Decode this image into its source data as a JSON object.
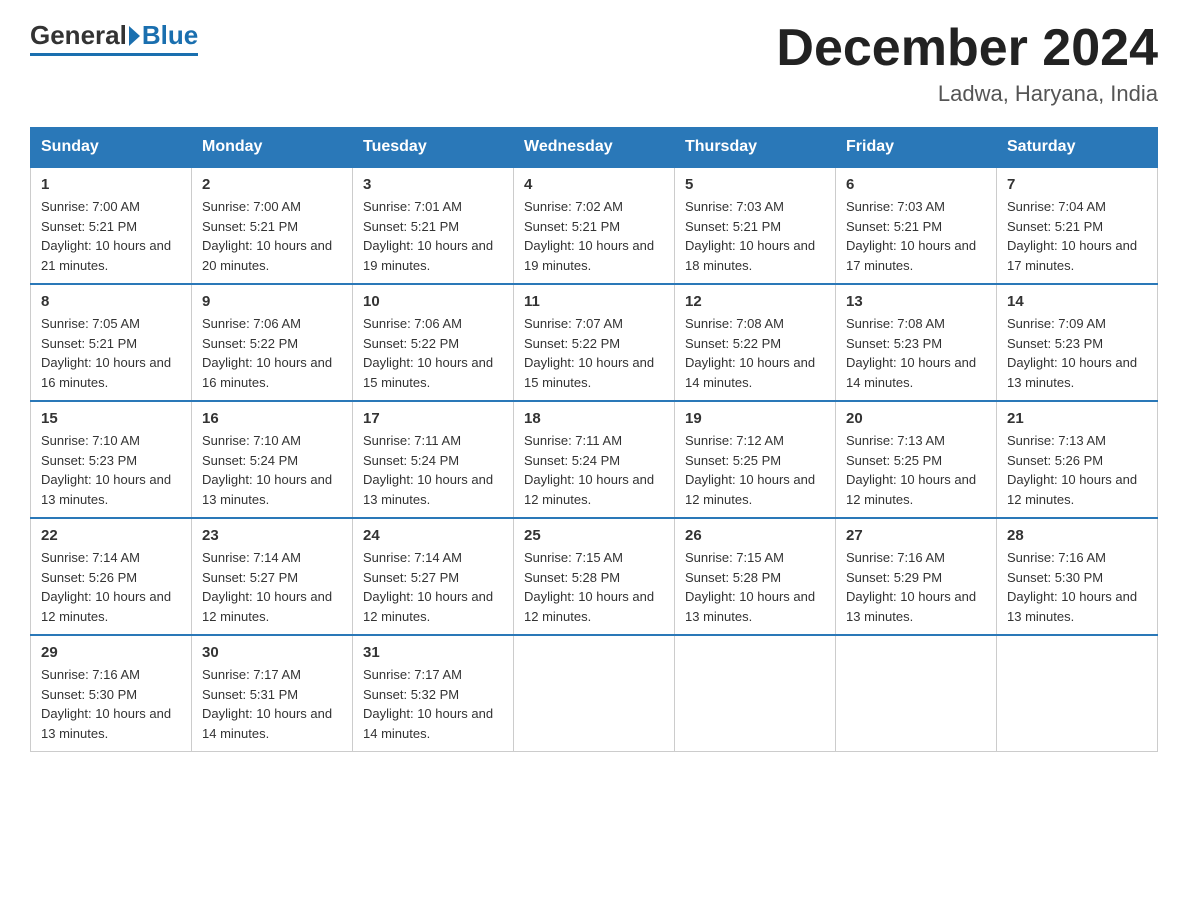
{
  "header": {
    "logo_general": "General",
    "logo_blue": "Blue",
    "month_title": "December 2024",
    "location": "Ladwa, Haryana, India"
  },
  "weekdays": [
    "Sunday",
    "Monday",
    "Tuesday",
    "Wednesday",
    "Thursday",
    "Friday",
    "Saturday"
  ],
  "weeks": [
    [
      {
        "day": "1",
        "sunrise": "7:00 AM",
        "sunset": "5:21 PM",
        "daylight": "10 hours and 21 minutes."
      },
      {
        "day": "2",
        "sunrise": "7:00 AM",
        "sunset": "5:21 PM",
        "daylight": "10 hours and 20 minutes."
      },
      {
        "day": "3",
        "sunrise": "7:01 AM",
        "sunset": "5:21 PM",
        "daylight": "10 hours and 19 minutes."
      },
      {
        "day": "4",
        "sunrise": "7:02 AM",
        "sunset": "5:21 PM",
        "daylight": "10 hours and 19 minutes."
      },
      {
        "day": "5",
        "sunrise": "7:03 AM",
        "sunset": "5:21 PM",
        "daylight": "10 hours and 18 minutes."
      },
      {
        "day": "6",
        "sunrise": "7:03 AM",
        "sunset": "5:21 PM",
        "daylight": "10 hours and 17 minutes."
      },
      {
        "day": "7",
        "sunrise": "7:04 AM",
        "sunset": "5:21 PM",
        "daylight": "10 hours and 17 minutes."
      }
    ],
    [
      {
        "day": "8",
        "sunrise": "7:05 AM",
        "sunset": "5:21 PM",
        "daylight": "10 hours and 16 minutes."
      },
      {
        "day": "9",
        "sunrise": "7:06 AM",
        "sunset": "5:22 PM",
        "daylight": "10 hours and 16 minutes."
      },
      {
        "day": "10",
        "sunrise": "7:06 AM",
        "sunset": "5:22 PM",
        "daylight": "10 hours and 15 minutes."
      },
      {
        "day": "11",
        "sunrise": "7:07 AM",
        "sunset": "5:22 PM",
        "daylight": "10 hours and 15 minutes."
      },
      {
        "day": "12",
        "sunrise": "7:08 AM",
        "sunset": "5:22 PM",
        "daylight": "10 hours and 14 minutes."
      },
      {
        "day": "13",
        "sunrise": "7:08 AM",
        "sunset": "5:23 PM",
        "daylight": "10 hours and 14 minutes."
      },
      {
        "day": "14",
        "sunrise": "7:09 AM",
        "sunset": "5:23 PM",
        "daylight": "10 hours and 13 minutes."
      }
    ],
    [
      {
        "day": "15",
        "sunrise": "7:10 AM",
        "sunset": "5:23 PM",
        "daylight": "10 hours and 13 minutes."
      },
      {
        "day": "16",
        "sunrise": "7:10 AM",
        "sunset": "5:24 PM",
        "daylight": "10 hours and 13 minutes."
      },
      {
        "day": "17",
        "sunrise": "7:11 AM",
        "sunset": "5:24 PM",
        "daylight": "10 hours and 13 minutes."
      },
      {
        "day": "18",
        "sunrise": "7:11 AM",
        "sunset": "5:24 PM",
        "daylight": "10 hours and 12 minutes."
      },
      {
        "day": "19",
        "sunrise": "7:12 AM",
        "sunset": "5:25 PM",
        "daylight": "10 hours and 12 minutes."
      },
      {
        "day": "20",
        "sunrise": "7:13 AM",
        "sunset": "5:25 PM",
        "daylight": "10 hours and 12 minutes."
      },
      {
        "day": "21",
        "sunrise": "7:13 AM",
        "sunset": "5:26 PM",
        "daylight": "10 hours and 12 minutes."
      }
    ],
    [
      {
        "day": "22",
        "sunrise": "7:14 AM",
        "sunset": "5:26 PM",
        "daylight": "10 hours and 12 minutes."
      },
      {
        "day": "23",
        "sunrise": "7:14 AM",
        "sunset": "5:27 PM",
        "daylight": "10 hours and 12 minutes."
      },
      {
        "day": "24",
        "sunrise": "7:14 AM",
        "sunset": "5:27 PM",
        "daylight": "10 hours and 12 minutes."
      },
      {
        "day": "25",
        "sunrise": "7:15 AM",
        "sunset": "5:28 PM",
        "daylight": "10 hours and 12 minutes."
      },
      {
        "day": "26",
        "sunrise": "7:15 AM",
        "sunset": "5:28 PM",
        "daylight": "10 hours and 13 minutes."
      },
      {
        "day": "27",
        "sunrise": "7:16 AM",
        "sunset": "5:29 PM",
        "daylight": "10 hours and 13 minutes."
      },
      {
        "day": "28",
        "sunrise": "7:16 AM",
        "sunset": "5:30 PM",
        "daylight": "10 hours and 13 minutes."
      }
    ],
    [
      {
        "day": "29",
        "sunrise": "7:16 AM",
        "sunset": "5:30 PM",
        "daylight": "10 hours and 13 minutes."
      },
      {
        "day": "30",
        "sunrise": "7:17 AM",
        "sunset": "5:31 PM",
        "daylight": "10 hours and 14 minutes."
      },
      {
        "day": "31",
        "sunrise": "7:17 AM",
        "sunset": "5:32 PM",
        "daylight": "10 hours and 14 minutes."
      },
      null,
      null,
      null,
      null
    ]
  ],
  "labels": {
    "sunrise": "Sunrise: ",
    "sunset": "Sunset: ",
    "daylight": "Daylight: "
  }
}
